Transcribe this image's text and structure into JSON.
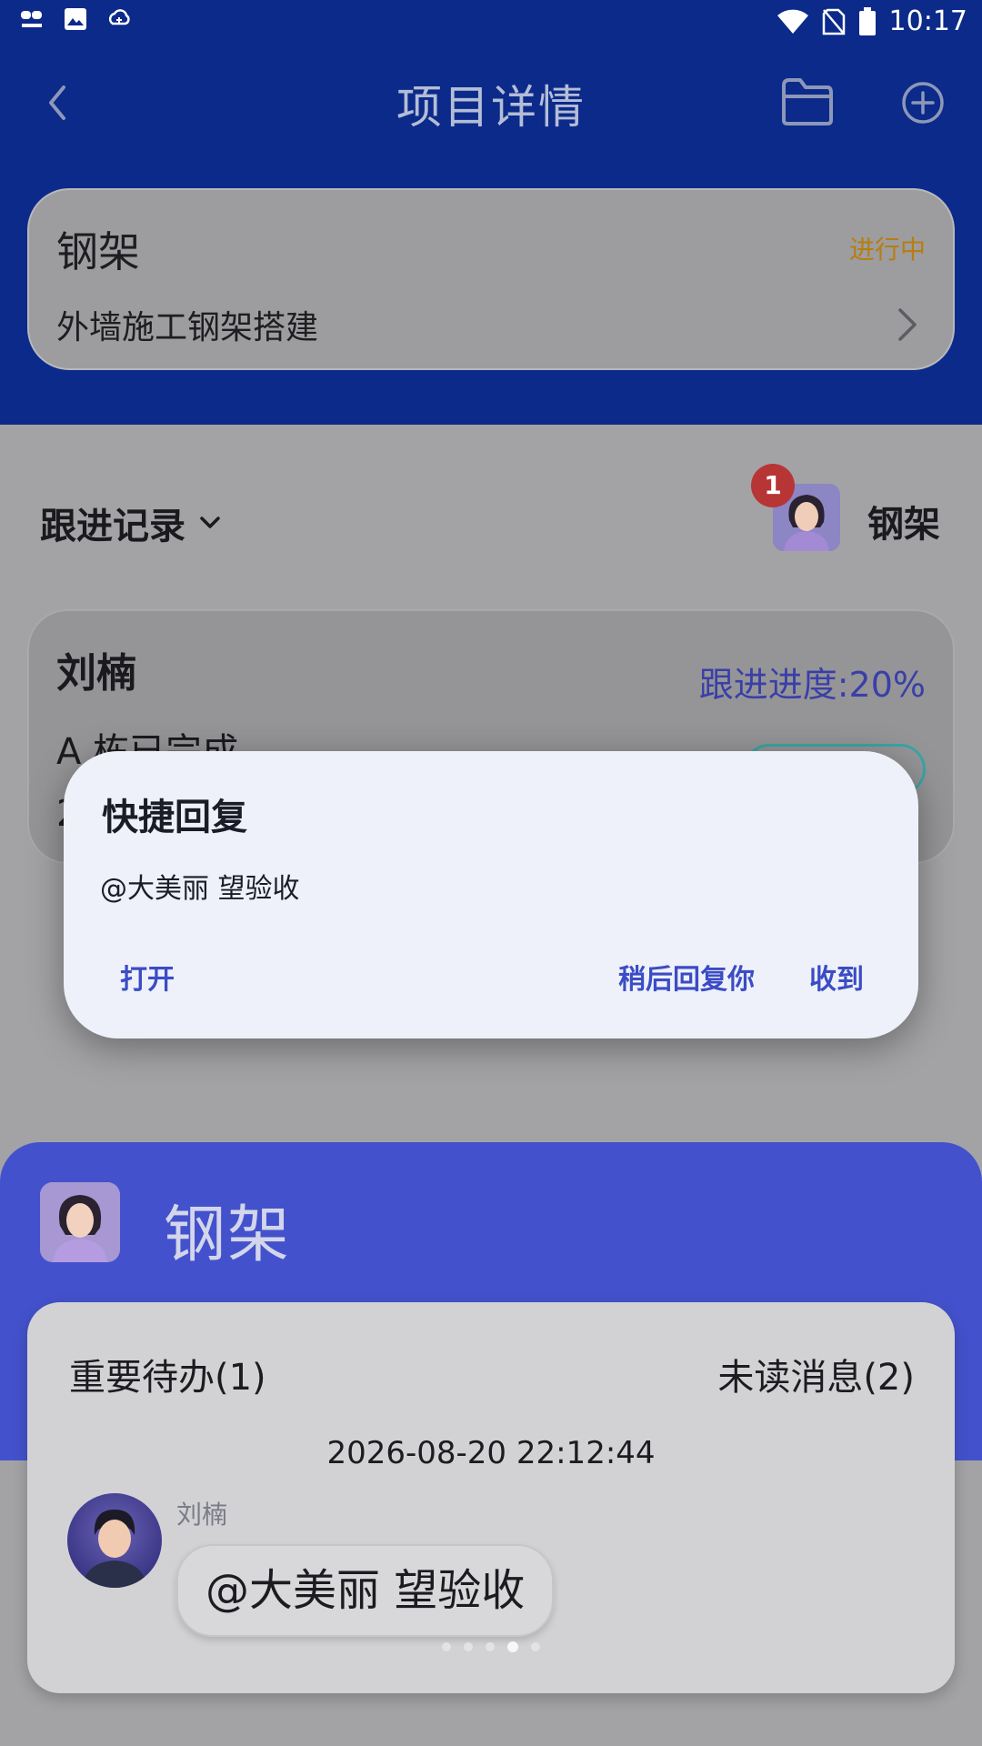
{
  "status_bar": {
    "time": "10:17",
    "icons_left": [
      "cloud-app-icon",
      "image-icon",
      "cloud-sync-icon"
    ],
    "icons_right": [
      "wifi-icon",
      "no-sim-icon",
      "battery-icon"
    ]
  },
  "header": {
    "title": "项目详情"
  },
  "project": {
    "name": "钢架",
    "status": "进行中",
    "description": "外墙施工钢架搭建"
  },
  "records": {
    "title": "跟进记录",
    "user_name": "钢架",
    "badge_count": "1"
  },
  "record_card": {
    "name": "刘楠",
    "progress": "跟进进度:20%",
    "line1": "A 栋已完成",
    "line2": "2"
  },
  "dialog": {
    "title": "快捷回复",
    "message": "@大美丽 望验收",
    "open_label": "打开",
    "later_label": "稍后回复你",
    "ok_label": "收到"
  },
  "notification": {
    "title": "钢架",
    "tab_todo": "重要待办(1)",
    "tab_unread": "未读消息(2)",
    "time": "2026-08-20 22:12:44",
    "sender": "刘楠",
    "message": "@大美丽 望验收",
    "page_dots": 5,
    "active_dot": 4
  },
  "colors": {
    "header_blue": "#0b2a8a",
    "status_orange": "#b77d10",
    "progress_blue": "#3a3fa8",
    "dialog_action": "#3b4cc5",
    "notif_blue": "#4352cc"
  }
}
